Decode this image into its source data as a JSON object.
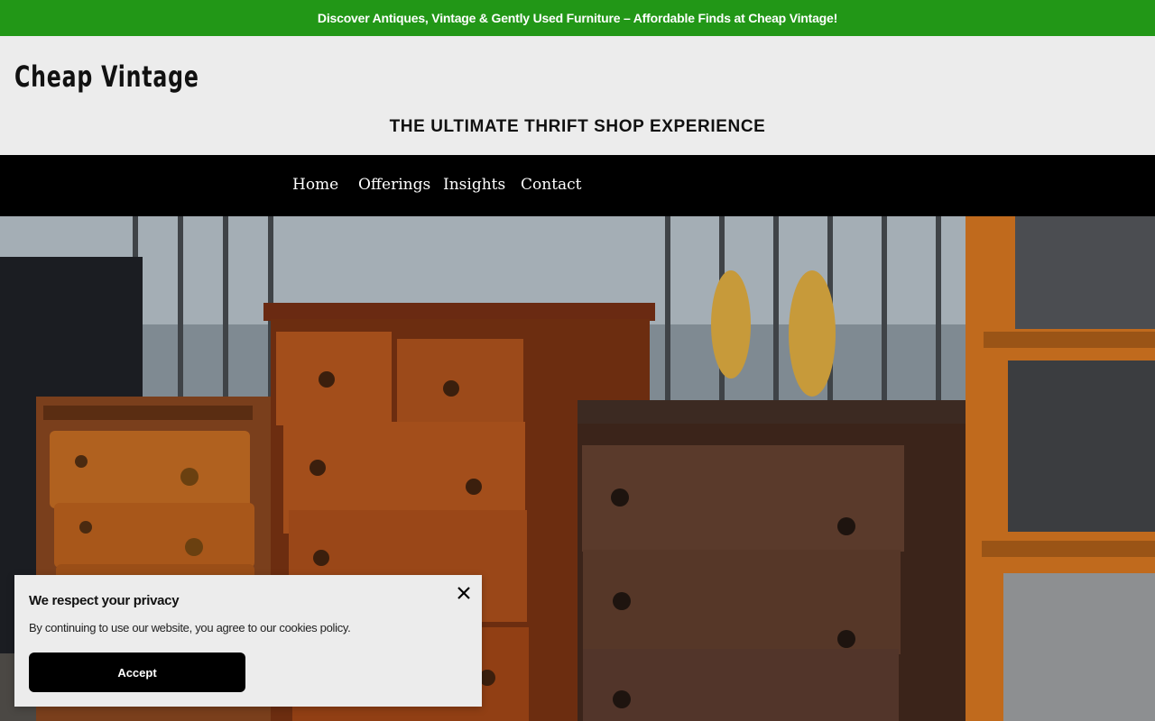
{
  "announcement": "Discover Antiques, Vintage & Gently Used Furniture – Affordable Finds at Cheap Vintage!",
  "site": {
    "title": "Cheap Vintage",
    "tagline": "THE ULTIMATE THRIFT SHOP EXPERIENCE"
  },
  "nav": {
    "items": [
      "Home",
      "Offerings",
      "Insights",
      "Contact"
    ]
  },
  "cookie": {
    "title": "We respect your privacy",
    "text": "By continuing to use our website, you agree to our cookies policy.",
    "accept_label": "Accept"
  },
  "colors": {
    "announcement_bg": "#229717",
    "nav_bg": "#000000",
    "header_bg": "#ececec"
  },
  "icons": {
    "close": "close-icon"
  }
}
